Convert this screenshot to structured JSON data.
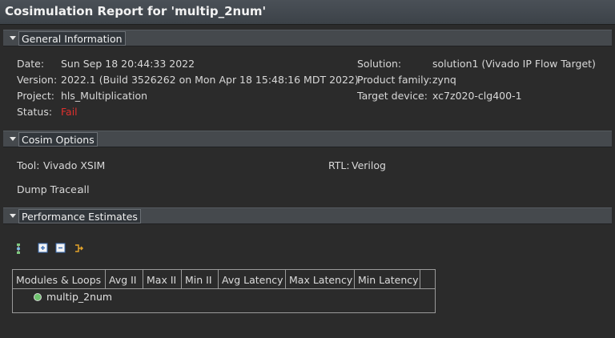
{
  "title": "Cosimulation Report for 'multip_2num'",
  "sections": {
    "general": "General Information",
    "cosim": "Cosim Options",
    "perf": "Performance Estimates"
  },
  "general": {
    "date_label": "Date:",
    "date_value": "Sun Sep 18 20:44:33 2022",
    "version_label": "Version:",
    "version_value": "2022.1 (Build 3526262 on Mon Apr 18 15:48:16 MDT 2022)",
    "project_label": "Project:",
    "project_value": "hls_Multiplication",
    "status_label": "Status:",
    "status_value": "Fail",
    "solution_label": "Solution:",
    "solution_value": "solution1 (Vivado IP Flow Target)",
    "family_label": "Product family:",
    "family_value": "zynq",
    "device_label": "Target device:",
    "device_value": "xc7z020-clg400-1"
  },
  "cosim": {
    "tool_label": "Tool:",
    "tool_value": "Vivado XSIM",
    "rtl_label": "RTL:",
    "rtl_value": "Verilog",
    "dump_label": "Dump Trace:",
    "dump_value": "all"
  },
  "perf": {
    "columns": [
      "Modules & Loops",
      "Avg II",
      "Max II",
      "Min II",
      "Avg Latency",
      "Max Latency",
      "Min Latency"
    ],
    "rows": [
      {
        "name": "multip_2num"
      }
    ]
  },
  "colors": {
    "fail": "#e0302e",
    "status_dot": "#6ec26e"
  }
}
